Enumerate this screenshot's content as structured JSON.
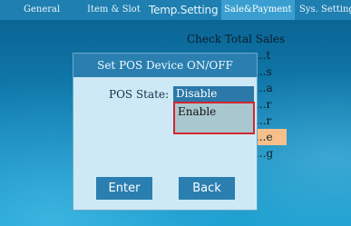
{
  "tabs": [
    {
      "label": "General"
    },
    {
      "label": "Item & Slot"
    },
    {
      "label": "Temp.Setting"
    },
    {
      "label": "Sale&Payment"
    },
    {
      "label": "Sys. Setting"
    }
  ],
  "menu": {
    "items": [
      {
        "label": "Check Total Sales"
      },
      {
        "label": "...t"
      },
      {
        "label": "...s"
      },
      {
        "label": "...a"
      },
      {
        "label": "...r"
      },
      {
        "label": "...r"
      },
      {
        "label": "...e"
      },
      {
        "label": "...g"
      }
    ]
  },
  "dialog": {
    "title": "Set POS Device ON/OFF",
    "field_label": "POS State:",
    "selected": "Disable",
    "options": [
      "Enable"
    ],
    "enter": "Enter",
    "back": "Back"
  }
}
